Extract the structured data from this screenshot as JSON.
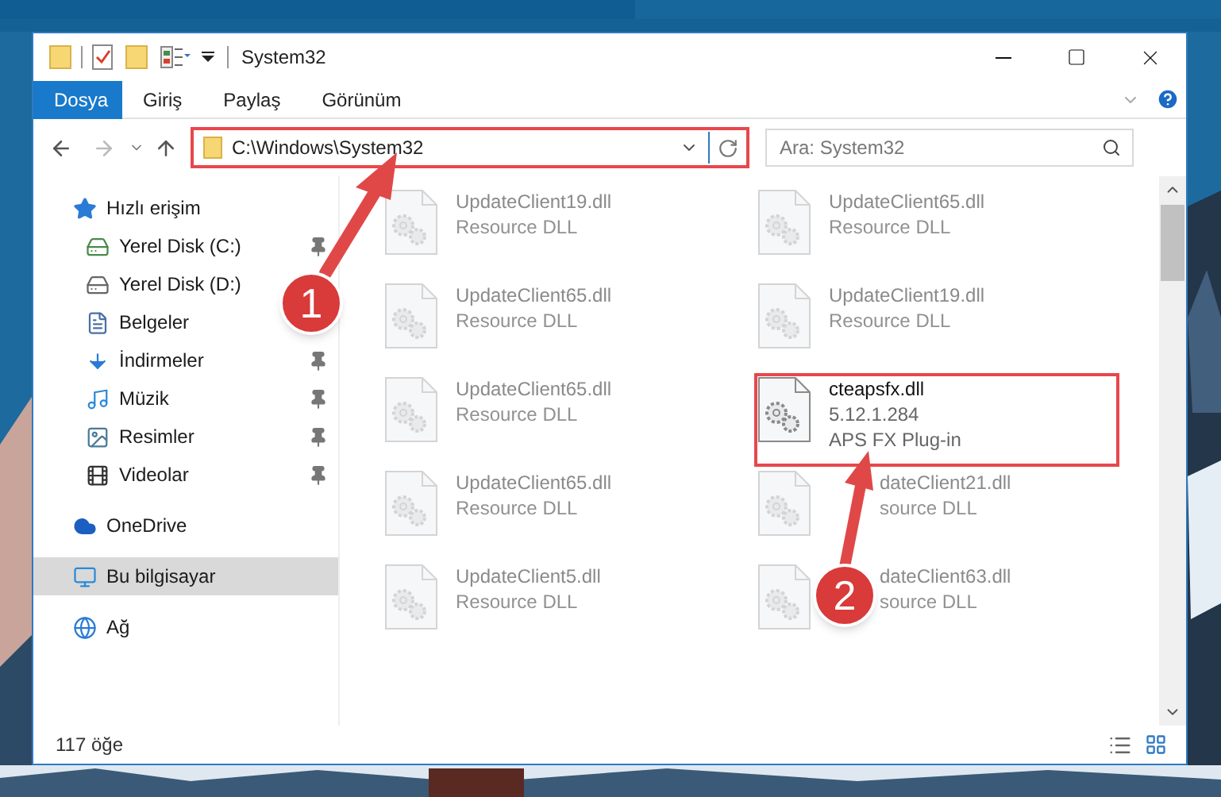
{
  "window": {
    "title": "System32"
  },
  "ribbon_tabs": [
    {
      "label": "Dosya",
      "selected": true
    },
    {
      "label": "Giriş",
      "selected": false
    },
    {
      "label": "Paylaş",
      "selected": false
    },
    {
      "label": "Görünüm",
      "selected": false
    }
  ],
  "address": {
    "value": "C:\\Windows\\System32"
  },
  "search": {
    "placeholder": "Ara: System32"
  },
  "sidebar": {
    "items": [
      {
        "label": "Hızlı erişim",
        "kind": "star",
        "selected": false,
        "children": [
          {
            "label": "Yerel Disk (C:)",
            "kind": "disk-c",
            "pinned": true
          },
          {
            "label": "Yerel Disk (D:)",
            "kind": "disk",
            "pinned": false
          },
          {
            "label": "Belgeler",
            "kind": "documents",
            "pinned": false
          },
          {
            "label": "İndirmeler",
            "kind": "downloads",
            "pinned": true
          },
          {
            "label": "Müzik",
            "kind": "music",
            "pinned": true
          },
          {
            "label": "Resimler",
            "kind": "pictures",
            "pinned": true
          },
          {
            "label": "Videolar",
            "kind": "videos",
            "pinned": true
          }
        ]
      },
      {
        "label": "OneDrive",
        "kind": "cloud",
        "selected": false
      },
      {
        "label": "Bu bilgisayar",
        "kind": "computer",
        "selected": true
      },
      {
        "label": "Ağ",
        "kind": "network",
        "selected": false
      }
    ]
  },
  "files": [
    {
      "name": "UpdateClient19.dll",
      "lines": [
        "Resource DLL"
      ],
      "selected": false,
      "kind": "plain"
    },
    {
      "name": "UpdateClient65.dll",
      "lines": [
        "Resource DLL"
      ],
      "selected": false,
      "kind": "plain"
    },
    {
      "name": "UpdateClient65.dll",
      "lines": [
        "Resource DLL"
      ],
      "selected": false,
      "kind": "plain"
    },
    {
      "name": "UpdateClient19.dll",
      "lines": [
        "Resource DLL"
      ],
      "selected": false,
      "kind": "plain"
    },
    {
      "name": "UpdateClient65.dll",
      "lines": [
        "Resource DLL"
      ],
      "selected": false,
      "kind": "plain"
    },
    {
      "name": "cteapsfx.dll",
      "lines": [
        "5.12.1.284",
        "APS FX Plug-in"
      ],
      "selected": true,
      "kind": "plain"
    },
    {
      "name": "UpdateClient65.dll",
      "lines": [
        "Resource DLL"
      ],
      "selected": false,
      "kind": "plain"
    },
    {
      "name": "dateClient21.dll",
      "lines": [
        "source DLL"
      ],
      "selected": false,
      "kind": "covered"
    },
    {
      "name": "UpdateClient5.dll",
      "lines": [
        "Resource DLL"
      ],
      "selected": false,
      "kind": "plain"
    },
    {
      "name": "dateClient63.dll",
      "lines": [
        "source DLL"
      ],
      "selected": false,
      "kind": "covered"
    }
  ],
  "status_bar": {
    "count": "117 öğe"
  },
  "annotations": [
    {
      "number": "1"
    },
    {
      "number": "2"
    }
  ]
}
